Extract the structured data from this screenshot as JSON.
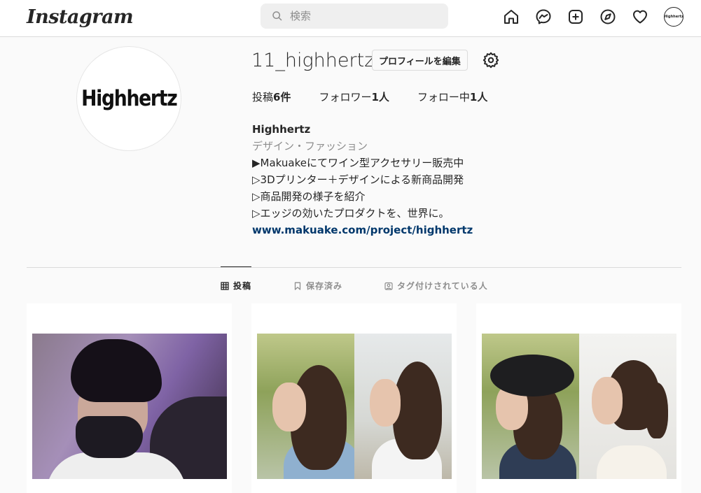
{
  "nav": {
    "logo": "Instagram",
    "search_placeholder": "検索",
    "icons": [
      "home-icon",
      "messenger-icon",
      "new-post-icon",
      "explore-icon",
      "activity-icon"
    ],
    "avatar_text": "Highhertz"
  },
  "profile": {
    "avatar_text": "Highhertz",
    "username": "11_highhertz",
    "edit_label": "プロフィールを編集",
    "stats": {
      "posts_label": "投稿",
      "posts_count": "6件",
      "followers_label": "フォロワー",
      "followers_count": "1人",
      "following_label": "フォロー中",
      "following_count": "1人"
    },
    "bio": {
      "name": "Highhertz",
      "category": "デザイン・ファッション",
      "lines": [
        "▶Makuakeにてワイン型アクセサリー販売中",
        "▷3Dプリンター＋デザインによる新商品開発",
        "▷商品開発の様子を紹介",
        "▷エッジの効いたプロダクトを、世界に。"
      ],
      "link": "www.makuake.com/project/highhertz"
    }
  },
  "tabs": {
    "posts": "投稿",
    "saved": "保存済み",
    "tagged": "タグ付けされている人",
    "active": "posts"
  },
  "colors": {
    "link": "#00376b",
    "muted": "#8e8e8e",
    "border": "#dbdbdb",
    "text": "#262626"
  }
}
